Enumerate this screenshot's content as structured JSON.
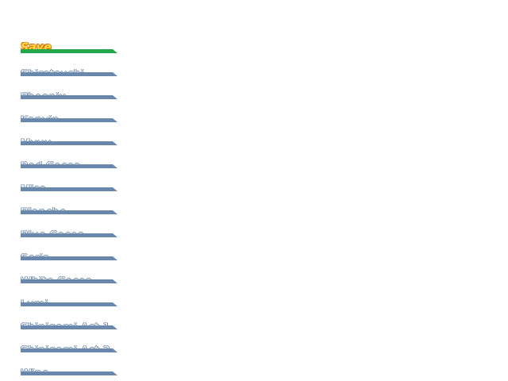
{
  "menu": {
    "items": [
      {
        "label": "Save",
        "selected": true
      },
      {
        "label": "Shirotsuchi"
      },
      {
        "label": "Phoenix"
      },
      {
        "label": "Kanyin"
      },
      {
        "label": "Myuu"
      },
      {
        "label": "Red Cocoa"
      },
      {
        "label": "Misa"
      },
      {
        "label": "Blanche"
      },
      {
        "label": "Blue Cocoa"
      },
      {
        "label": "Seria"
      },
      {
        "label": "White Cocoa"
      },
      {
        "label": "Lumi"
      },
      {
        "label": "Shinigami Act 1"
      },
      {
        "label": "Shinigami Act 2"
      },
      {
        "label": "Wine"
      }
    ],
    "colors": {
      "selected_bar": "#22a84a",
      "bar": "#6a88ab",
      "selected_text": "#ffe23a",
      "selected_outline": "#e06a10"
    }
  }
}
